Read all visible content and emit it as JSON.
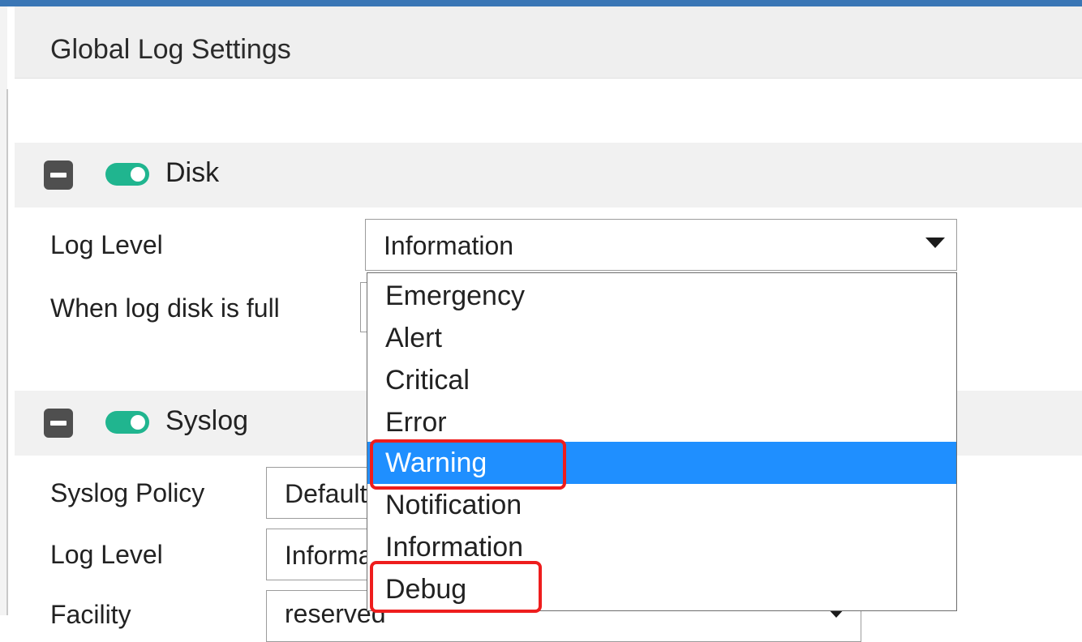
{
  "page": {
    "title": "Global Log Settings"
  },
  "disk": {
    "title": "Disk",
    "log_level_label": "Log Level",
    "log_level_value": "Information",
    "when_full_label": "When log disk is full"
  },
  "syslog": {
    "title": "Syslog",
    "policy_label": "Syslog Policy",
    "policy_value": "Default",
    "log_level_label": "Log Level",
    "log_level_value": "Information",
    "facility_label": "Facility",
    "facility_value": "reserved"
  },
  "dropdown": {
    "options": [
      "Emergency",
      "Alert",
      "Critical",
      "Error",
      "Warning",
      "Notification",
      "Information",
      "Debug"
    ],
    "selected": "Warning",
    "highlighted": [
      "Warning",
      "Debug"
    ]
  },
  "colors": {
    "header_bar": "#3a76b5",
    "toggle_on": "#20b58f",
    "selection": "#1f8fff",
    "highlight_box": "#ee1d1d"
  },
  "icons": [
    "collapse-icon",
    "toggle-switch",
    "dropdown-caret-icon"
  ]
}
